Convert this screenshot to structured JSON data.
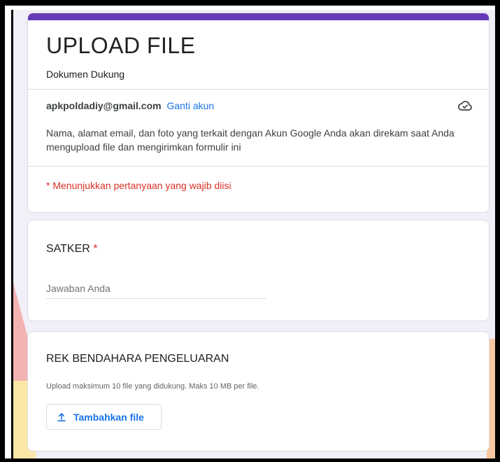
{
  "form": {
    "title": "UPLOAD FILE",
    "description": "Dokumen Dukung",
    "account_email": "apkpoldadiy@gmail.com",
    "switch_account_label": "Ganti akun",
    "cloud_icon": "cloud-done-icon",
    "privacy_notice": "Nama, alamat email, dan foto yang terkait dengan Akun Google Anda akan direkam saat Anda mengupload file dan mengirimkan formulir ini",
    "required_note": "* Menunjukkan pertanyaan yang wajib diisi",
    "accent_color": "#673ab7"
  },
  "questions": {
    "satker": {
      "label": "SATKER",
      "required_mark": "*",
      "placeholder": "Jawaban Anda"
    },
    "rek": {
      "label": "REK BENDAHARA PENGELUARAN",
      "helper": "Upload maksimum 10 file yang didukung. Maks 10 MB per file.",
      "button_label": "Tambahkan file",
      "button_icon": "upload-icon"
    }
  }
}
